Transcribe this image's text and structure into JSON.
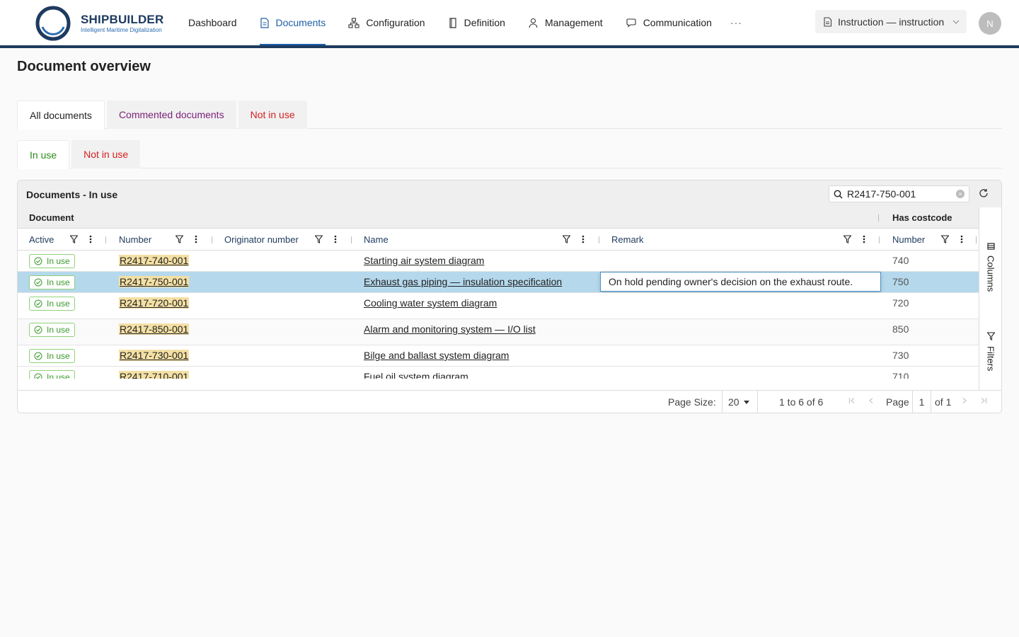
{
  "brand": {
    "name": "SHIPBUILDER",
    "tagline": "Intelligent Maritime Digitalization"
  },
  "nav": {
    "items": [
      {
        "label": "Dashboard",
        "icon": "none"
      },
      {
        "label": "Documents",
        "icon": "document-icon",
        "active": true
      },
      {
        "label": "Configuration",
        "icon": "hierarchy-icon"
      },
      {
        "label": "Definition",
        "icon": "book-icon"
      },
      {
        "label": "Management",
        "icon": "user-icon"
      },
      {
        "label": "Communication",
        "icon": "chat-icon"
      }
    ],
    "more": "···",
    "instruction_label": "Instruction — instruction",
    "avatar_initial": "N"
  },
  "page": {
    "title": "Document overview"
  },
  "tabs_primary": [
    {
      "label": "All documents",
      "active": true
    },
    {
      "label": "Commented documents"
    },
    {
      "label": "Not in use"
    }
  ],
  "tabs_secondary": [
    {
      "label": "In use",
      "active": true
    },
    {
      "label": "Not in use"
    }
  ],
  "grid": {
    "title": "Documents - In use",
    "search_value": "R2417-750-001",
    "group_headers": {
      "document": "Document",
      "costcode": "Has costcode"
    },
    "columns": {
      "active": "Active",
      "number": "Number",
      "originator": "Originator number",
      "name": "Name",
      "remark": "Remark",
      "cost_number": "Number"
    },
    "rows": [
      {
        "status": "In use",
        "number": "R2417-740-001",
        "name": "Starting air system diagram",
        "remark": "",
        "cost": "740"
      },
      {
        "status": "In use",
        "number": "R2417-750-001",
        "name": "Exhaust gas piping — insulation specification",
        "remark": "On hold pending owner's decision on the exhaust route.",
        "cost": "750",
        "selected": true
      },
      {
        "status": "In use",
        "number": "R2417-720-001",
        "name": "Cooling water system diagram",
        "remark": "",
        "cost": "720"
      },
      {
        "status": "In use",
        "number": "R2417-850-001",
        "name": "Alarm and monitoring system — I/O list",
        "remark": "",
        "cost": "850"
      },
      {
        "status": "In use",
        "number": "R2417-730-001",
        "name": "Bilge and ballast system diagram",
        "remark": "",
        "cost": "730"
      },
      {
        "status": "In use",
        "number": "R2417-710-001",
        "name": "Fuel oil system diagram",
        "remark": "",
        "cost": "710"
      }
    ],
    "side_panel": {
      "columns": "Columns",
      "filters": "Filters"
    },
    "footer": {
      "page_size_label": "Page Size:",
      "page_size": "20",
      "range": "1 to 6 of 6",
      "page_label": "Page",
      "page": "1",
      "of": "of 1"
    }
  },
  "colors": {
    "accent": "#1e5fa8",
    "brand": "#1e3a5f",
    "selected_row": "#b5d8ec",
    "in_use_green": "#3a9a2a",
    "not_in_use_red": "#d62020"
  }
}
